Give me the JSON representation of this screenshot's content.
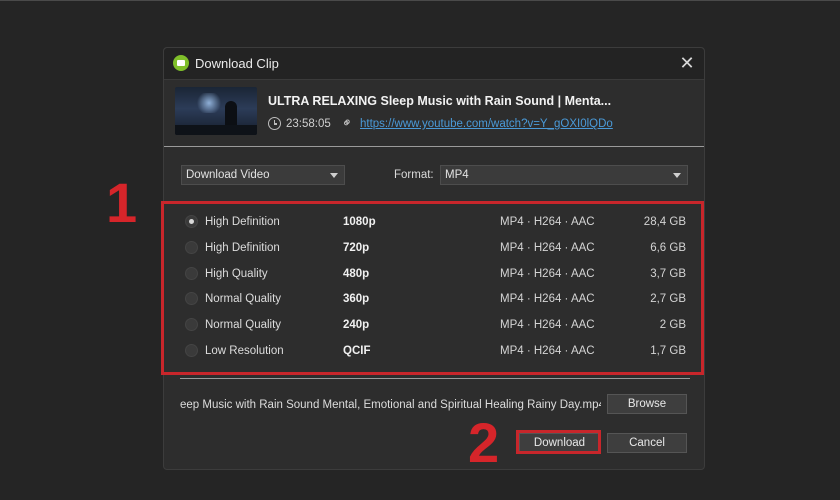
{
  "dialog": {
    "title": "Download Clip",
    "close_label": "✕"
  },
  "video": {
    "title": "ULTRA RELAXING Sleep Music with Rain Sound | Menta...",
    "duration": "23:58:05",
    "url": "https://www.youtube.com/watch?v=Y_gOXI0lQDo"
  },
  "options": {
    "download_type": "Download Video",
    "format_label": "Format:",
    "format_value": "MP4"
  },
  "qualities": [
    {
      "label": "High Definition",
      "resolution": "1080p",
      "format": "MP4 · H264 · AAC",
      "size": "28,4 GB",
      "selected": true
    },
    {
      "label": "High Definition",
      "resolution": "720p",
      "format": "MP4 · H264 · AAC",
      "size": "6,6 GB",
      "selected": false
    },
    {
      "label": "High Quality",
      "resolution": "480p",
      "format": "MP4 · H264 · AAC",
      "size": "3,7 GB",
      "selected": false
    },
    {
      "label": "Normal Quality",
      "resolution": "360p",
      "format": "MP4 · H264 · AAC",
      "size": "2,7 GB",
      "selected": false
    },
    {
      "label": "Normal Quality",
      "resolution": "240p",
      "format": "MP4 · H264 · AAC",
      "size": "2 GB",
      "selected": false
    },
    {
      "label": "Low Resolution",
      "resolution": "QCIF",
      "format": "MP4 · H264 · AAC",
      "size": "1,7 GB",
      "selected": false
    }
  ],
  "output": {
    "filename": "eep Music with Rain Sound  Mental, Emotional and Spiritual Healing  Rainy Day.mp4",
    "browse_label": "Browse"
  },
  "actions": {
    "download_label": "Download",
    "cancel_label": "Cancel"
  },
  "annotations": {
    "step1": "1",
    "step2": "2",
    "highlight_color": "#c8262b"
  },
  "colors": {
    "link": "#4a9ad8",
    "app_icon": "#7fbf2a"
  }
}
